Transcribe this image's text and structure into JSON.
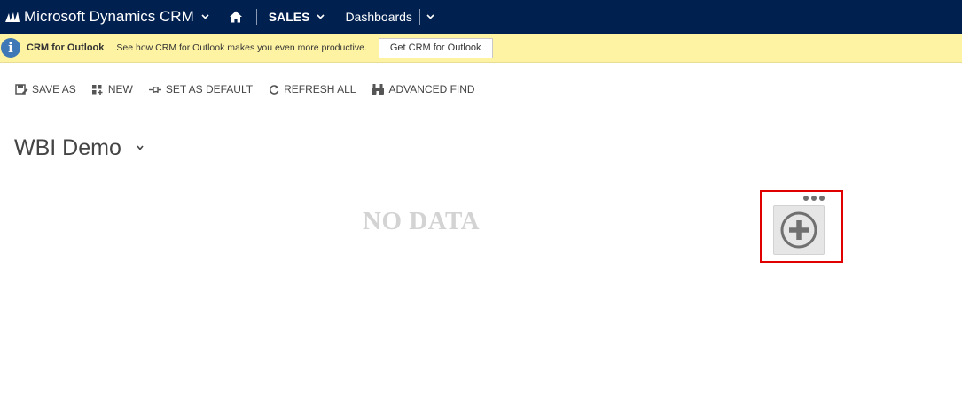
{
  "navbar": {
    "app_title": "Microsoft Dynamics CRM",
    "area_label": "SALES",
    "subarea_label": "Dashboards",
    "icons": [
      "dynamics-logo-icon",
      "chevron-down-icon",
      "home-icon"
    ],
    "colors": {
      "background": "#002050",
      "text": "#ffffff"
    }
  },
  "notification": {
    "title": "CRM for Outlook",
    "message": "See how CRM for Outlook makes you even more productive.",
    "button_label": "Get CRM for Outlook",
    "icon": "info-icon",
    "colors": {
      "background": "#fdf3a3",
      "icon": "#3f78b6"
    }
  },
  "commandbar": {
    "items": [
      {
        "label": "SAVE AS",
        "icon": "save-as-icon"
      },
      {
        "label": "NEW",
        "icon": "new-icon"
      },
      {
        "label": "SET AS DEFAULT",
        "icon": "pin-icon"
      },
      {
        "label": "REFRESH ALL",
        "icon": "refresh-icon"
      },
      {
        "label": "ADVANCED FIND",
        "icon": "binoculars-icon"
      }
    ]
  },
  "dashboard": {
    "title": "WBI Demo",
    "empty_text": "NO DATA",
    "add_component_icon": "plus-circle-icon",
    "more_icon": "more-dots-icon",
    "colors": {
      "highlight": "#e00000",
      "empty_text": "#d3d3d3"
    }
  }
}
